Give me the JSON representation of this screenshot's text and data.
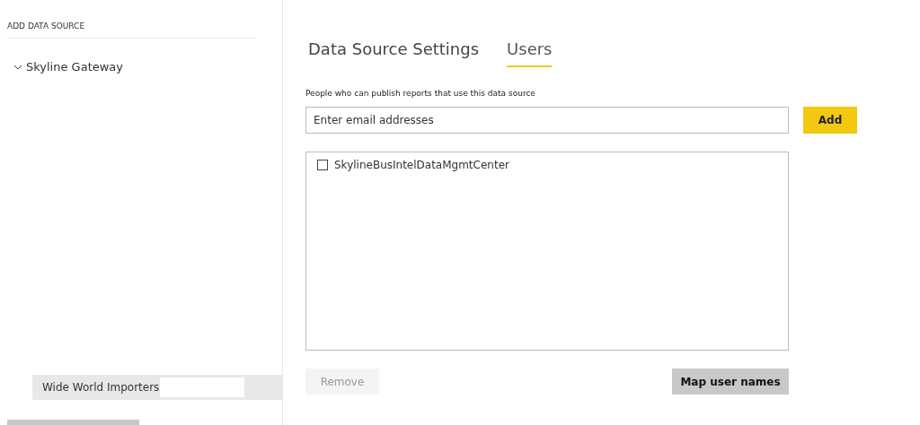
{
  "sidebar": {
    "title": "ADD DATA SOURCE",
    "tree": [
      {
        "label": "Skyline Gateway",
        "expanded": true
      }
    ],
    "data_sources": [
      {
        "label": "Wide World Importers",
        "selected": true
      }
    ]
  },
  "tabs": [
    {
      "label": "Data Source Settings",
      "selected": false
    },
    {
      "label": "Users",
      "selected": true
    }
  ],
  "description": "People who can publish reports that use this data source",
  "email_field": {
    "placeholder": "Enter email addresses"
  },
  "add_button": {
    "label": "Add"
  },
  "users": [
    {
      "name": "SkylineBusIntelDataMgmtCenter",
      "checked": false
    }
  ],
  "remove_button": {
    "label": "Remove",
    "disabled": true
  },
  "map_button": {
    "label": "Map user names",
    "disabled": false
  }
}
